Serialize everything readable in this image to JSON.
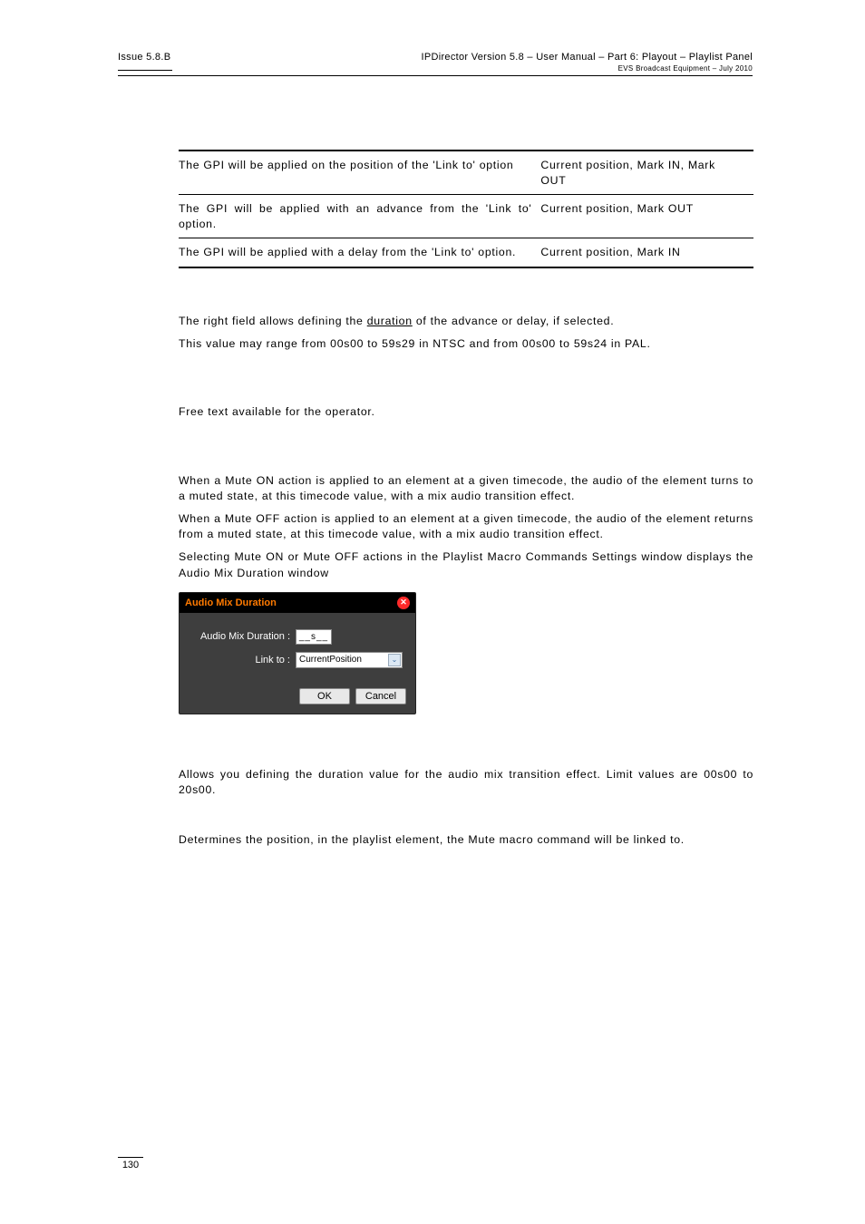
{
  "header": {
    "issue": "Issue 5.8.B",
    "title": "IPDirector Version 5.8 – User Manual – Part 6: Playout – Playlist Panel",
    "sub": "EVS Broadcast Equipment – July 2010"
  },
  "table": {
    "rows": [
      {
        "a": "The GPI will be applied on the position of the 'Link to' option",
        "b": "Current position, Mark IN, Mark OUT"
      },
      {
        "a": "The GPI will be applied with an advance from the 'Link to' option.",
        "b": "Current position, Mark OUT"
      },
      {
        "a": "The GPI will be applied with a delay from the 'Link to' option.",
        "b": "Current position, Mark IN"
      }
    ]
  },
  "p1a_pre": "The right field allows defining the ",
  "p1a_u": "duration",
  "p1a_post": " of the advance or delay, if selected.",
  "p1b": "This value may range from 00s00 to 59s29 in NTSC and from 00s00 to 59s24 in PAL.",
  "p2": "Free text available for the operator.",
  "p3a": "When a Mute ON action is applied to an element at a given timecode, the audio of the element turns to a muted state, at this timecode value, with a mix audio transition effect.",
  "p3b": "When a Mute OFF action is applied to an element at a given timecode, the audio of the element returns from a muted state, at this timecode value, with a mix audio transition effect.",
  "p3c": "Selecting Mute ON or Mute OFF actions in the Playlist Macro Commands Settings window displays the Audio Mix Duration window",
  "dialog": {
    "title": "Audio Mix Duration",
    "amd_label": "Audio Mix Duration :",
    "amd_value": "__s__",
    "linkto_label": "Link to :",
    "linkto_value": "CurrentPosition",
    "ok": "OK",
    "cancel": "Cancel"
  },
  "p4": "Allows you defining the duration value for the audio mix transition effect. Limit values are 00s00 to 20s00.",
  "p5": "Determines the position, in the playlist element, the Mute macro command will be linked to.",
  "pagenum": "130"
}
